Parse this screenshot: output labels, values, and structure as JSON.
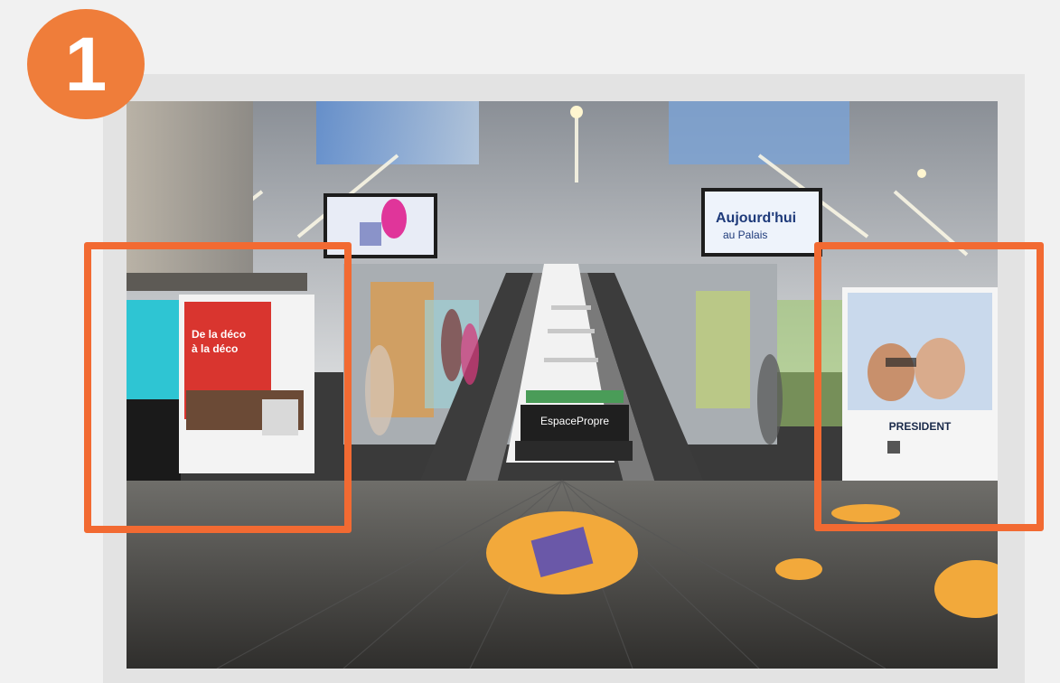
{
  "badge": {
    "number": "1"
  },
  "colors": {
    "accent": "#f26a32",
    "badge": "#ef7d3a",
    "frame": "#e3e3e3",
    "background": "#f1f1f1"
  },
  "photo": {
    "screen_left_text": "Aujourd'hui",
    "screen_right_line1": "Aujourd'hui",
    "screen_right_line2": "au Palais",
    "left_ad_heading_1": "De la déco",
    "left_ad_heading_2": "à la déco",
    "stairs_brand": "EspacePropre",
    "right_ad_brand": "PRESIDENT"
  },
  "highlights": [
    {
      "name": "left-highlight",
      "color": "#f26a32"
    },
    {
      "name": "right-highlight",
      "color": "#f26a32"
    }
  ]
}
